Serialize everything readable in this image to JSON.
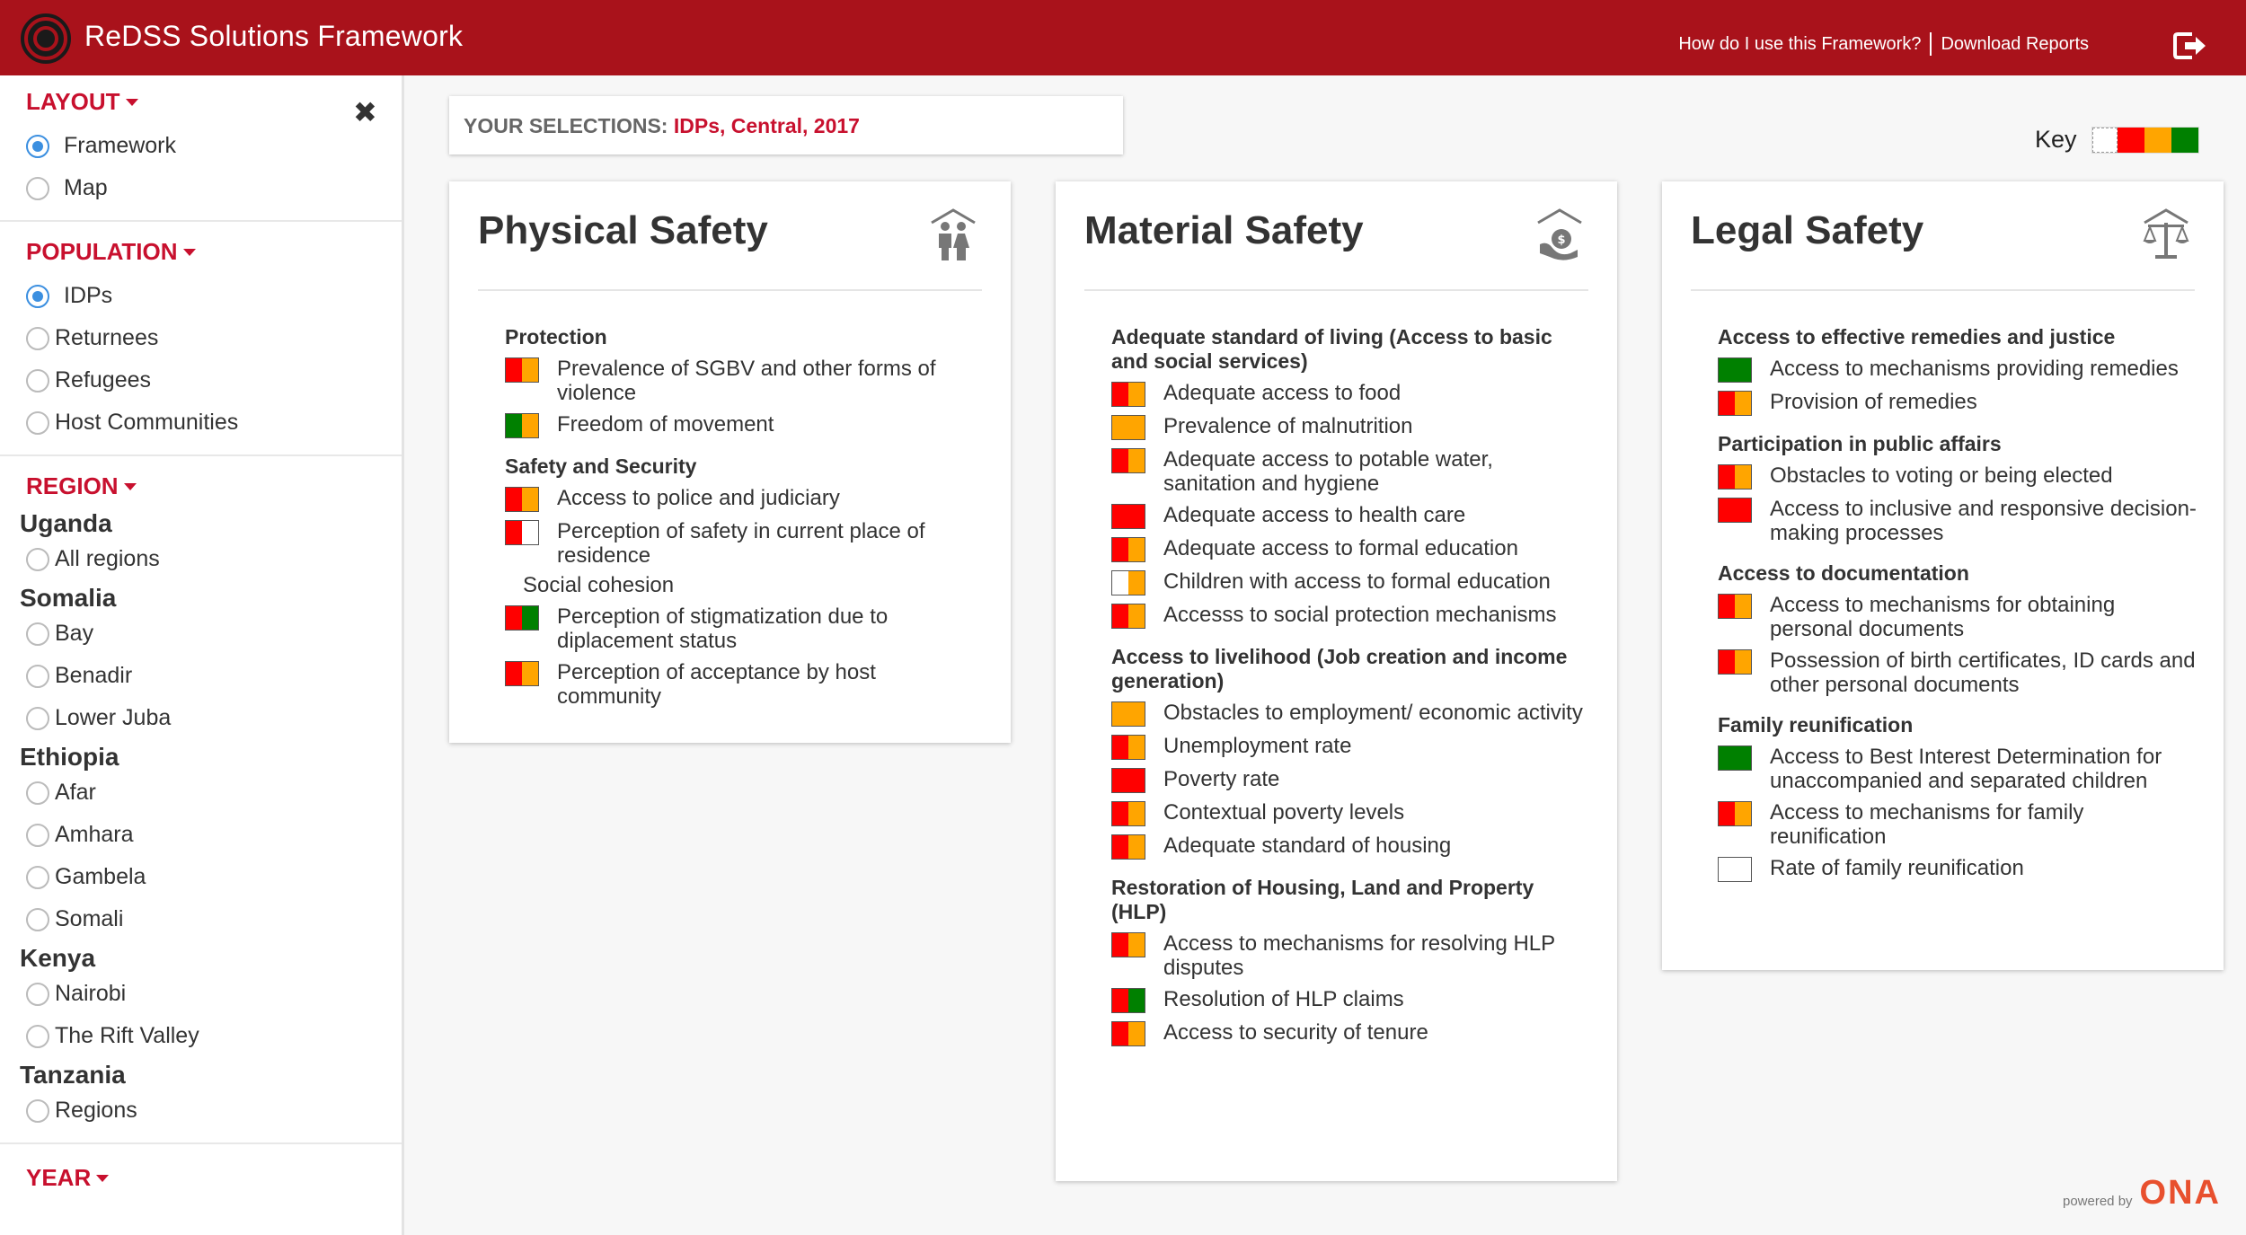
{
  "colors": {
    "brand": "#a9121b",
    "accent": "#c8102e",
    "red": "#ff0000",
    "orange": "#ffa500",
    "green": "#008000",
    "white": "#ffffff"
  },
  "header": {
    "title": "ReDSS Solutions Framework",
    "how_link": "How do I use this Framework?",
    "download_link": "Download Reports",
    "logout_icon": "logout-icon"
  },
  "sidebar": {
    "layout": {
      "title": "LAYOUT",
      "options": [
        "Framework",
        "Map"
      ],
      "selected": "Framework"
    },
    "population": {
      "title": "POPULATION",
      "options": [
        "IDPs",
        "Returnees",
        "Refugees",
        "Host Communities"
      ],
      "selected": "IDPs"
    },
    "region": {
      "title": "REGION",
      "countries": [
        {
          "name": "Uganda",
          "regions": [
            "All regions"
          ]
        },
        {
          "name": "Somalia",
          "regions": [
            "Bay",
            "Benadir",
            "Lower Juba"
          ]
        },
        {
          "name": "Ethiopia",
          "regions": [
            "Afar",
            "Amhara",
            "Gambela",
            "Somali"
          ]
        },
        {
          "name": "Kenya",
          "regions": [
            "Nairobi",
            "The Rift Valley"
          ]
        },
        {
          "name": "Tanzania",
          "regions": [
            "Regions"
          ]
        }
      ]
    },
    "year": {
      "title": "YEAR"
    }
  },
  "selections": {
    "label": "YOUR SELECTIONS:",
    "value": "IDPs, Central, 2017"
  },
  "key": {
    "label": "Key",
    "swatches": [
      "white",
      "red",
      "orange",
      "green"
    ]
  },
  "cards": [
    {
      "title": "Physical Safety",
      "icon": "people-icon",
      "groups": [
        {
          "heading": "Protection",
          "items": [
            {
              "text": "Prevalence of SGBV and other forms of violence",
              "colors": [
                "red",
                "orange"
              ]
            },
            {
              "text": "Freedom of movement",
              "colors": [
                "green",
                "orange"
              ]
            }
          ]
        },
        {
          "heading": "Safety and Security",
          "items": [
            {
              "text": "Access to police and judiciary",
              "colors": [
                "red",
                "orange"
              ]
            },
            {
              "text": "Perception of safety in current place of residence",
              "colors": [
                "red",
                "white"
              ]
            }
          ]
        },
        {
          "heading": "Social cohesion",
          "plain": true,
          "items": [
            {
              "text": "Perception of stigmatization due to diplacement status",
              "colors": [
                "red",
                "green"
              ]
            },
            {
              "text": "Perception of acceptance by host community",
              "colors": [
                "red",
                "orange"
              ]
            }
          ]
        }
      ]
    },
    {
      "title": "Material Safety",
      "icon": "hand-money-icon",
      "groups": [
        {
          "heading": "Adequate standard of living (Access to basic and social services)",
          "items": [
            {
              "text": "Adequate access to food",
              "colors": [
                "red",
                "orange"
              ]
            },
            {
              "text": "Prevalence of malnutrition",
              "colors": [
                "orange",
                "orange"
              ]
            },
            {
              "text": "Adequate access to potable water, sanitation and hygiene",
              "colors": [
                "red",
                "orange"
              ]
            },
            {
              "text": "Adequate access to health care",
              "colors": [
                "red",
                "red"
              ]
            },
            {
              "text": "Adequate access to formal education",
              "colors": [
                "red",
                "orange"
              ]
            },
            {
              "text": "Children with access to formal education",
              "colors": [
                "white",
                "orange"
              ]
            },
            {
              "text": "Accesss to social protection mechanisms",
              "colors": [
                "red",
                "orange"
              ]
            }
          ]
        },
        {
          "heading": "Access to livelihood (Job creation and income generation)",
          "items": [
            {
              "text": "Obstacles to employment/ economic activity",
              "colors": [
                "orange",
                "orange"
              ]
            },
            {
              "text": "Unemployment rate",
              "colors": [
                "red",
                "orange"
              ]
            },
            {
              "text": "Poverty rate",
              "colors": [
                "red",
                "red"
              ]
            },
            {
              "text": "Contextual poverty levels",
              "colors": [
                "red",
                "orange"
              ]
            },
            {
              "text": "Adequate standard of housing",
              "colors": [
                "red",
                "orange"
              ]
            }
          ]
        },
        {
          "heading": "Restoration of Housing, Land and Property (HLP)",
          "items": [
            {
              "text": "Access to mechanisms for resolving HLP disputes",
              "colors": [
                "red",
                "orange"
              ]
            },
            {
              "text": "Resolution of HLP claims",
              "colors": [
                "red",
                "green"
              ]
            },
            {
              "text": "Access to security of tenure",
              "colors": [
                "red",
                "orange"
              ]
            }
          ]
        }
      ]
    },
    {
      "title": "Legal Safety",
      "icon": "scales-icon",
      "groups": [
        {
          "heading": "Access to effective remedies and justice",
          "items": [
            {
              "text": "Access to mechanisms providing remedies",
              "colors": [
                "green",
                "green"
              ]
            },
            {
              "text": "Provision of remedies",
              "colors": [
                "red",
                "orange"
              ]
            }
          ]
        },
        {
          "heading": "Participation in public affairs",
          "items": [
            {
              "text": "Obstacles to voting or being elected",
              "colors": [
                "red",
                "orange"
              ]
            },
            {
              "text": "Access to inclusive and responsive decision-making processes",
              "colors": [
                "red",
                "red"
              ]
            }
          ]
        },
        {
          "heading": "Access to documentation",
          "items": [
            {
              "text": "Access to mechanisms for obtaining personal documents",
              "colors": [
                "red",
                "orange"
              ]
            },
            {
              "text": "Possession of birth certificates, ID cards and other personal documents",
              "colors": [
                "red",
                "orange"
              ]
            }
          ]
        },
        {
          "heading": "Family reunification",
          "items": [
            {
              "text": "Access to Best Interest Determination for unaccompanied and separated children",
              "colors": [
                "green",
                "green"
              ]
            },
            {
              "text": "Access to mechanisms for family reunification",
              "colors": [
                "red",
                "orange"
              ]
            },
            {
              "text": "Rate of family reunification",
              "colors": [
                "white",
                "white"
              ]
            }
          ]
        }
      ]
    }
  ],
  "footer": {
    "powered_by": "powered by",
    "brand": "ONA"
  }
}
